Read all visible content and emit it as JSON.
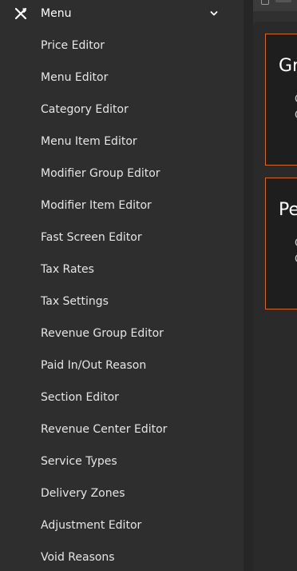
{
  "sidebar": {
    "header": {
      "label": "Menu",
      "icon": "utensils-icon",
      "chevron_icon": "chevron-down-icon"
    },
    "items": [
      {
        "label": "Price Editor"
      },
      {
        "label": "Menu Editor"
      },
      {
        "label": "Category Editor"
      },
      {
        "label": "Menu Item Editor"
      },
      {
        "label": "Modifier Group Editor"
      },
      {
        "label": "Modifier Item Editor"
      },
      {
        "label": "Fast Screen Editor"
      },
      {
        "label": "Tax Rates"
      },
      {
        "label": "Tax Settings"
      },
      {
        "label": "Revenue Group Editor"
      },
      {
        "label": "Paid In/Out Reason"
      },
      {
        "label": "Section Editor"
      },
      {
        "label": "Revenue Center Editor"
      },
      {
        "label": "Service Types"
      },
      {
        "label": "Delivery Zones"
      },
      {
        "label": "Adjustment Editor"
      },
      {
        "label": "Void Reasons"
      }
    ]
  },
  "main": {
    "cards": [
      {
        "title": "Gr",
        "line1": "C",
        "line2": "C"
      },
      {
        "title": "Pe",
        "line1": "C",
        "line2": "C"
      }
    ]
  },
  "colors": {
    "sidebar_bg": "#2e2e2e",
    "card_border": "#d2692a",
    "text": "#ffffff"
  }
}
